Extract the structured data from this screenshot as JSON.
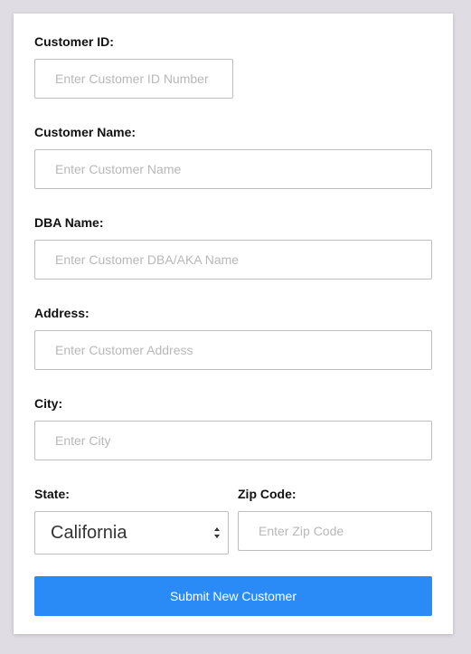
{
  "form": {
    "customer_id": {
      "label": "Customer ID:",
      "placeholder": "Enter Customer ID Number",
      "value": ""
    },
    "customer_name": {
      "label": "Customer Name:",
      "placeholder": "Enter Customer Name",
      "value": ""
    },
    "dba_name": {
      "label": "DBA Name:",
      "placeholder": "Enter Customer DBA/AKA Name",
      "value": ""
    },
    "address": {
      "label": "Address:",
      "placeholder": "Enter Customer Address",
      "value": ""
    },
    "city": {
      "label": "City:",
      "placeholder": "Enter City",
      "value": ""
    },
    "state": {
      "label": "State:",
      "selected": "California",
      "icon": "select-arrows-icon"
    },
    "zip": {
      "label": "Zip Code:",
      "placeholder": "Enter Zip Code",
      "value": ""
    },
    "submit_label": "Submit New Customer"
  },
  "colors": {
    "page_background": "#dfdde3",
    "card_background": "#ffffff",
    "button": "#2a8bf6",
    "border": "#bdbdbd",
    "placeholder": "#b8b8b8"
  }
}
